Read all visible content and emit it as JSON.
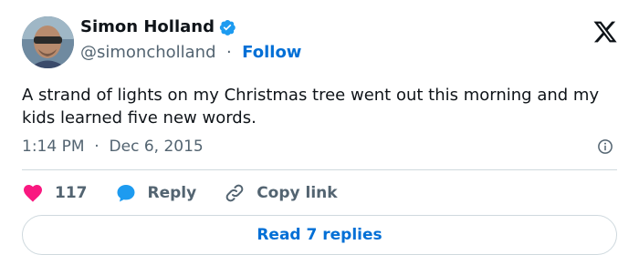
{
  "author": {
    "display_name": "Simon Holland",
    "handle": "@simoncholland",
    "separator": "·",
    "follow_label": "Follow"
  },
  "tweet": {
    "text": "A strand of lights on my Christmas tree went out this morning and my kids learned five new words.",
    "time": "1:14 PM",
    "date_separator": "·",
    "date": "Dec 6, 2015"
  },
  "actions": {
    "like_count": "117",
    "reply_label": "Reply",
    "copy_link_label": "Copy link"
  },
  "read_replies_label": "Read 7 replies",
  "colors": {
    "link_blue": "#006fd6",
    "verified_blue": "#1d9bf0",
    "like_pink": "#f91880",
    "muted_gray": "#536471",
    "divider": "#cfd9de"
  },
  "icons": [
    "verified-badge-icon",
    "x-logo-icon",
    "info-icon",
    "heart-icon",
    "reply-bubble-icon",
    "link-icon"
  ]
}
